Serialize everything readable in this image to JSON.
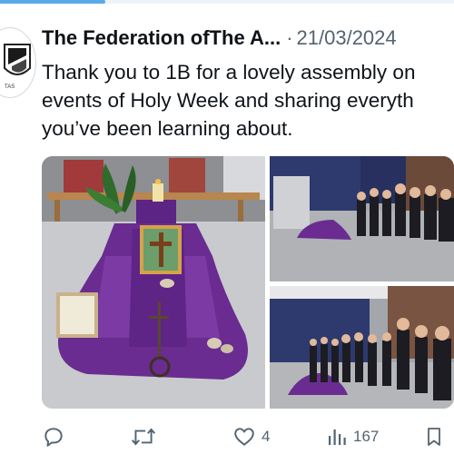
{
  "tweet": {
    "author_name": "The Federation ofThe A...",
    "separator": "·",
    "date": "21/03/2024",
    "text_lines": [
      "Thank you to 1B for a lovely assembly on",
      "events of Holy Week and sharing everyth",
      "you’ve been learning about."
    ],
    "avatar_text": "TAS"
  },
  "actions": {
    "reply": {
      "icon": "reply-icon",
      "count": ""
    },
    "retweet": {
      "icon": "retweet-icon",
      "count": ""
    },
    "like": {
      "icon": "heart-icon",
      "count": "4"
    },
    "views": {
      "icon": "views-icon",
      "count": "167"
    },
    "bookmark": {
      "icon": "bookmark-icon",
      "count": ""
    }
  },
  "colors": {
    "text_primary": "#0f1419",
    "text_secondary": "#536471",
    "cloth_purple": "#6a2c91",
    "accent_blue": "#5aa9e6"
  }
}
